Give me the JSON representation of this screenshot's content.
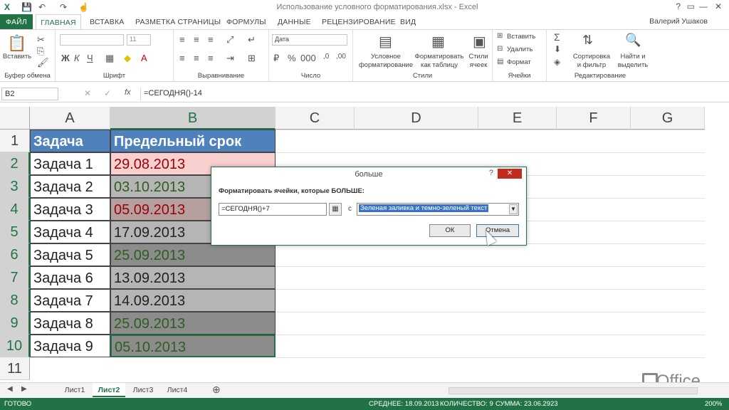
{
  "window": {
    "title": "Использование условного форматирования.xlsx - Excel",
    "user": "Валерий Ушаков"
  },
  "tabs": [
    "ФАЙЛ",
    "ГЛАВНАЯ",
    "ВСТАВКА",
    "РАЗМЕТКА СТРАНИЦЫ",
    "ФОРМУЛЫ",
    "ДАННЫЕ",
    "РЕЦЕНЗИРОВАНИЕ",
    "ВИД"
  ],
  "ribbon": {
    "clipboard": {
      "paste": "Вставить",
      "label": "Буфер обмена"
    },
    "font": {
      "label": "Шрифт",
      "size": "11"
    },
    "alignment": {
      "label": "Выравнивание"
    },
    "number": {
      "label": "Число",
      "format": "Дата"
    },
    "styles": {
      "label": "Стили",
      "cond1": "Условное",
      "cond2": "форматирование",
      "table1": "Форматировать",
      "table2": "как таблицу",
      "cell1": "Стили",
      "cell2": "ячеек"
    },
    "cells": {
      "label": "Ячейки",
      "insert": "Вставить",
      "delete": "Удалить",
      "format": "Формат"
    },
    "editing": {
      "label": "Редактирование",
      "sort1": "Сортировка",
      "sort2": "и фильтр",
      "find1": "Найти и",
      "find2": "выделить"
    }
  },
  "formula_bar": {
    "name_box": "B2",
    "formula": "=СЕГОДНЯ()-14",
    "fx": "fx"
  },
  "columns": [
    "A",
    "B",
    "C",
    "D",
    "E",
    "F",
    "G"
  ],
  "rows": [
    "1",
    "2",
    "3",
    "4",
    "5",
    "6",
    "7",
    "8",
    "9",
    "10",
    "11"
  ],
  "table": {
    "header": [
      "Задача",
      "Предельный срок"
    ],
    "data": [
      {
        "task": "Задача 1",
        "date": "29.08.2013"
      },
      {
        "task": "Задача 2",
        "date": "03.10.2013"
      },
      {
        "task": "Задача 3",
        "date": "05.09.2013"
      },
      {
        "task": "Задача 4",
        "date": "17.09.2013"
      },
      {
        "task": "Задача 5",
        "date": "25.09.2013"
      },
      {
        "task": "Задача 6",
        "date": "13.09.2013"
      },
      {
        "task": "Задача 7",
        "date": "14.09.2013"
      },
      {
        "task": "Задача 8",
        "date": "25.09.2013"
      },
      {
        "task": "Задача 9",
        "date": "05.10.2013"
      }
    ]
  },
  "dialog": {
    "title": "больше",
    "help": "?",
    "close": "✕",
    "label": "Форматировать ячейки, которые БОЛЬШЕ:",
    "input": "=СЕГОДНЯ()+7",
    "with": "с",
    "format": "Зеленая заливка и темно-зеленый текст",
    "ok": "ОК",
    "cancel": "Отмена"
  },
  "sheets": [
    "Лист1",
    "Лист2",
    "Лист3",
    "Лист4"
  ],
  "status": {
    "ready": "ГОТОВО",
    "average": "СРЕДНЕЕ: 18.09.2013",
    "count": "КОЛИЧЕСТВО: 9",
    "sum": "СУММА: 23.06.2923",
    "zoom": "200%"
  },
  "brand": "Office",
  "colors": {
    "accent": "#217346",
    "header_fill": "#4f81bd",
    "red_fill": "#f9d0d0",
    "red_text": "#9c0006",
    "green_text": "#2e5e1f",
    "dark_fill": "#8c8c8c"
  }
}
